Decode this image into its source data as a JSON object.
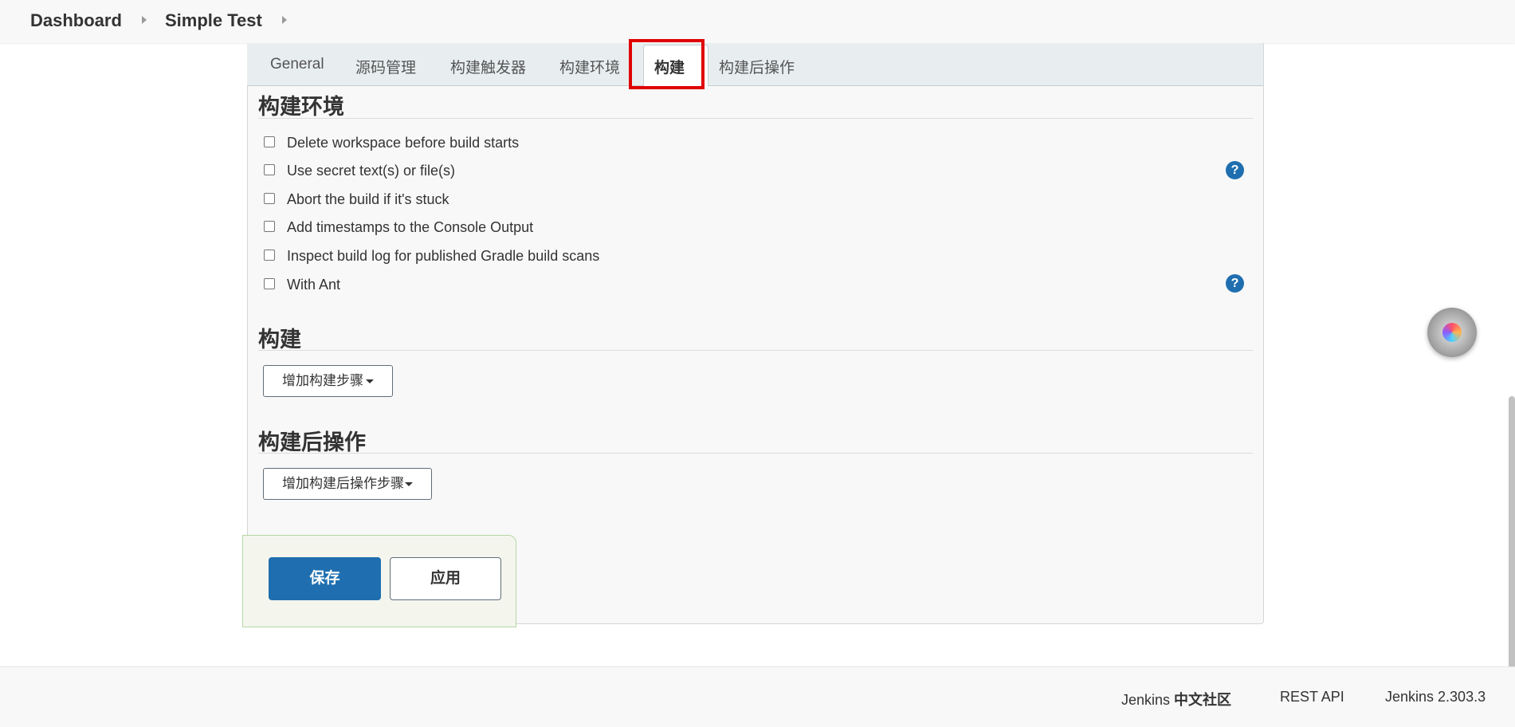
{
  "breadcrumb": {
    "items": [
      "Dashboard",
      "Simple Test"
    ]
  },
  "tabs": {
    "items": [
      "General",
      "源码管理",
      "构建触发器",
      "构建环境",
      "构建",
      "构建后操作"
    ],
    "active": "构建"
  },
  "build_env": {
    "title": "构建环境",
    "options": [
      {
        "label": "Delete workspace before build starts",
        "checked": false
      },
      {
        "label": "Use secret text(s) or file(s)",
        "checked": false
      },
      {
        "label": "Abort the build if it's stuck",
        "checked": false
      },
      {
        "label": "Add timestamps to the Console Output",
        "checked": false
      },
      {
        "label": "Inspect build log for published Gradle build scans",
        "checked": false
      },
      {
        "label": "With Ant",
        "checked": false
      }
    ],
    "help_glyph": "?"
  },
  "build": {
    "title": "构建",
    "add_step_label": "增加构建步骤"
  },
  "post_build": {
    "title": "构建后操作",
    "add_step_label": "增加构建后操作步骤"
  },
  "actions": {
    "save_label": "保存",
    "apply_label": "应用"
  },
  "footer": {
    "community_prefix": "Jenkins ",
    "community_bold": "中文社区",
    "rest_api": "REST API",
    "version": "Jenkins 2.303.3"
  },
  "colors": {
    "primary": "#1f6fb0",
    "highlight": "#e00000",
    "sticker_bg": "#f4f6ee",
    "sticker_border": "#b4d6a5"
  },
  "icons": {
    "help": "help-circle-icon",
    "caret": "caret-down-icon",
    "separator": "chevron-right-icon"
  }
}
